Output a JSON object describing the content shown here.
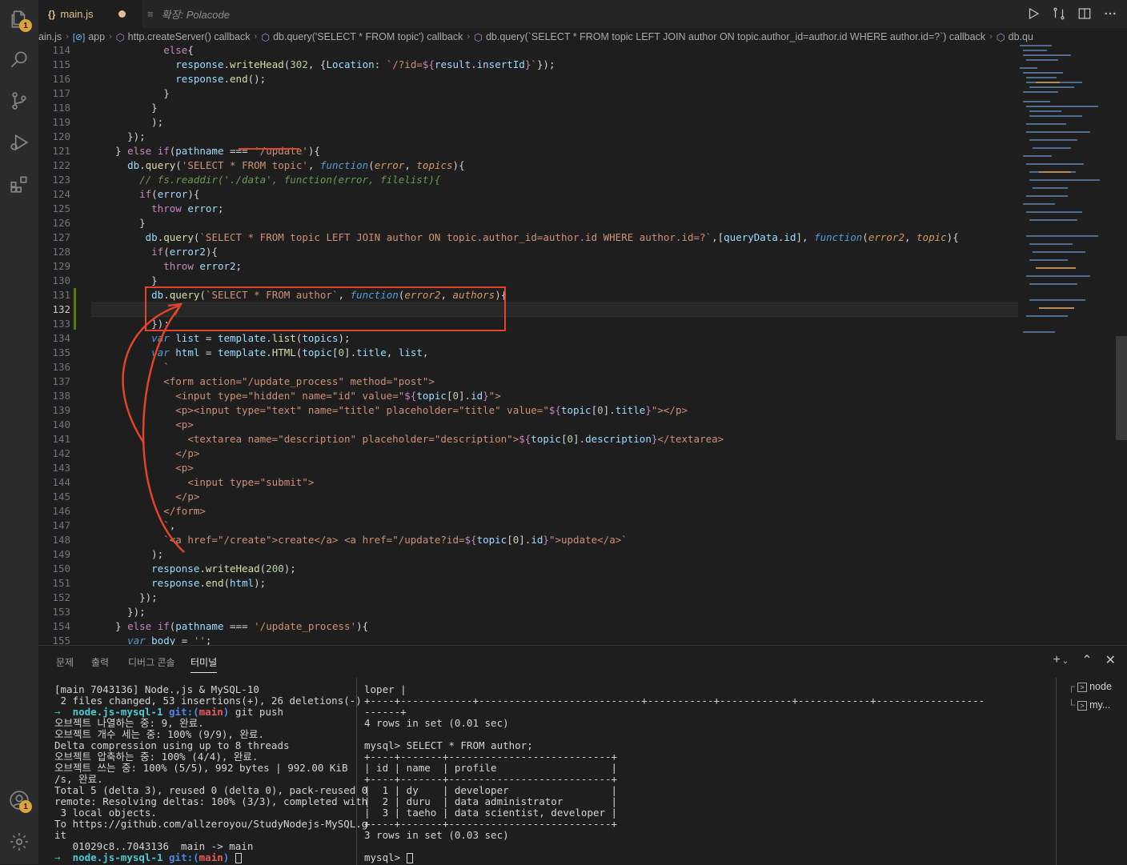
{
  "tabs": [
    {
      "icon": "{}",
      "label": "main.js",
      "modified": true,
      "active": true
    },
    {
      "icon": "≡",
      "label": "확장: Polacode",
      "active": false
    }
  ],
  "breadcrumbs": [
    "ain.js",
    "app",
    "http.createServer() callback",
    "db.query('SELECT * FROM topic') callback",
    "db.query(`SELECT * FROM topic LEFT JOIN author ON topic.author_id=author.id WHERE author.id=?`) callback",
    "db.qu"
  ],
  "activity_badges": {
    "explorer": "1",
    "account": "1"
  },
  "editor": {
    "current_line": 132,
    "lines": [
      {
        "n": 114,
        "html": "        <span class='kw'>else</span>{"
      },
      {
        "n": 115,
        "html": "          <span class='var'>response</span>.<span class='fn'>writeHead</span>(<span class='num'>302</span>, {<span class='var'>Location</span>: <span class='str'>`/?id=</span><span class='kw'>${</span><span class='var'>result</span>.<span class='var'>insertId</span><span class='kw'>}</span><span class='str'>`</span>});"
      },
      {
        "n": 116,
        "html": "          <span class='var'>response</span>.<span class='fn'>end</span>();"
      },
      {
        "n": 117,
        "html": "        }"
      },
      {
        "n": 118,
        "html": "      }"
      },
      {
        "n": 119,
        "html": "      );"
      },
      {
        "n": 120,
        "html": "  });"
      },
      {
        "n": 121,
        "html": "} <span class='kw'>else if</span>(<span class='var'>pathname</span> === <span class='str'>'/update'</span>){"
      },
      {
        "n": 122,
        "html": "  <span class='var'>db</span>.<span class='fn'>query</span>(<span class='str'>'SELECT * FROM topic'</span>, <span class='it'>function</span>(<span class='pm'>error</span>, <span class='pm'>topics</span>){"
      },
      {
        "n": 123,
        "html": "    <span class='cm'>// fs.readdir('./data', function(error, filelist){</span>"
      },
      {
        "n": 124,
        "html": "    <span class='kw'>if</span>(<span class='var'>error</span>){"
      },
      {
        "n": 125,
        "html": "      <span class='kw'>throw</span> <span class='var'>error</span>;"
      },
      {
        "n": 126,
        "html": "    }"
      },
      {
        "n": 127,
        "html": "     <span class='var'>db</span>.<span class='fn'>query</span>(<span class='str'>`SELECT * FROM topic LEFT JOIN author ON topic.author_id=author.id WHERE author.id=?`</span>,[<span class='var'>queryData</span>.<span class='var'>id</span>], <span class='it'>function</span>(<span class='pm'>error2</span>, <span class='pm'>topic</span>){"
      },
      {
        "n": 128,
        "html": "      <span class='kw'>if</span>(<span class='var'>error2</span>){"
      },
      {
        "n": 129,
        "html": "        <span class='kw'>throw</span> <span class='var'>error2</span>;"
      },
      {
        "n": 130,
        "html": "      }"
      },
      {
        "n": 131,
        "html": "      <span class='var'>db</span>.<span class='fn'>query</span>(<span class='str'>`SELECT * FROM author`</span>, <span class='it'>function</span>(<span class='pm'>error2</span>, <span class='pm'>authors</span>){"
      },
      {
        "n": 132,
        "html": ""
      },
      {
        "n": 133,
        "html": "      });"
      },
      {
        "n": 134,
        "html": "      <span class='it'>var</span> <span class='var'>list</span> = <span class='var'>template</span>.<span class='fn'>list</span>(<span class='var'>topics</span>);"
      },
      {
        "n": 135,
        "html": "      <span class='it'>var</span> <span class='var'>html</span> = <span class='var'>template</span>.<span class='fn'>HTML</span>(<span class='var'>topic</span>[<span class='num'>0</span>].<span class='var'>title</span>, <span class='var'>list</span>,"
      },
      {
        "n": 136,
        "html": "        <span class='str'>`</span>"
      },
      {
        "n": 137,
        "html": "        <span class='str'>&lt;form action=\"/update_process\" method=\"post\"&gt;</span>"
      },
      {
        "n": 138,
        "html": "          <span class='str'>&lt;input type=\"hidden\" name=\"id\" value=\"</span><span class='kw'>${</span><span class='var'>topic</span>[<span class='num'>0</span>].<span class='var'>id</span><span class='kw'>}</span><span class='str'>\"&gt;</span>"
      },
      {
        "n": 139,
        "html": "          <span class='str'>&lt;p&gt;&lt;input type=\"text\" name=\"title\" placeholder=\"title\" value=\"</span><span class='kw'>${</span><span class='var'>topic</span>[<span class='num'>0</span>].<span class='var'>title</span><span class='kw'>}</span><span class='str'>\"&gt;&lt;/p&gt;</span>"
      },
      {
        "n": 140,
        "html": "          <span class='str'>&lt;p&gt;</span>"
      },
      {
        "n": 141,
        "html": "            <span class='str'>&lt;textarea name=\"description\" placeholder=\"description\"&gt;</span><span class='kw'>${</span><span class='var'>topic</span>[<span class='num'>0</span>].<span class='var'>description</span><span class='kw'>}</span><span class='str'>&lt;/textarea&gt;</span>"
      },
      {
        "n": 142,
        "html": "          <span class='str'>&lt;/p&gt;</span>"
      },
      {
        "n": 143,
        "html": "          <span class='str'>&lt;p&gt;</span>"
      },
      {
        "n": 144,
        "html": "            <span class='str'>&lt;input type=\"submit\"&gt;</span>"
      },
      {
        "n": 145,
        "html": "          <span class='str'>&lt;/p&gt;</span>"
      },
      {
        "n": 146,
        "html": "        <span class='str'>&lt;/form&gt;</span>"
      },
      {
        "n": 147,
        "html": "        <span class='str'>`</span>,"
      },
      {
        "n": 148,
        "html": "        <span class='str'>`&lt;a href=\"/create\"&gt;create&lt;/a&gt; &lt;a href=\"/update?id=</span><span class='kw'>${</span><span class='var'>topic</span>[<span class='num'>0</span>].<span class='var'>id</span><span class='kw'>}</span><span class='str'>\"&gt;update&lt;/a&gt;`</span>"
      },
      {
        "n": 149,
        "html": "      );"
      },
      {
        "n": 150,
        "html": "      <span class='var'>response</span>.<span class='fn'>writeHead</span>(<span class='num'>200</span>);"
      },
      {
        "n": 151,
        "html": "      <span class='var'>response</span>.<span class='fn'>end</span>(<span class='var'>html</span>);"
      },
      {
        "n": 152,
        "html": "    });"
      },
      {
        "n": 153,
        "html": "  });"
      },
      {
        "n": 154,
        "html": "} <span class='kw'>else if</span>(<span class='var'>pathname</span> === <span class='str'>'/update_process'</span>){"
      },
      {
        "n": 155,
        "html": "  <span class='it'>var</span> <span class='var'>body</span> = <span class='str'>''</span>;"
      }
    ]
  },
  "panel_tabs": [
    "문제",
    "출력",
    "디버그 콘솔",
    "터미널"
  ],
  "active_panel_tab": "터미널",
  "terminal_left": [
    "[main 7043136] Node.,js & MySQL-10",
    " 2 files changed, 53 insertions(+), 26 deletions(-)",
    "→  node.js-mysql-1 git:(main) git push",
    "오브젝트 나열하는 중: 9, 완료.",
    "오브젝트 개수 세는 중: 100% (9/9), 완료.",
    "Delta compression using up to 8 threads",
    "오브젝트 압축하는 중: 100% (4/4), 완료.",
    "오브젝트 쓰는 중: 100% (5/5), 992 bytes | 992.00 KiB",
    "/s, 완료.",
    "Total 5 (delta 3), reused 0 (delta 0), pack-reused 0",
    "remote: Resolving deltas: 100% (3/3), completed with",
    " 3 local objects.",
    "To https://github.com/allzeroyou/StudyNodejs-MySQL.g",
    "it",
    "   01029c8..7043136  main -> main",
    "→  node.js-mysql-1 git:(main) "
  ],
  "terminal_right": [
    "loper |",
    "+----+------------+---------------------------+-----------+------------+------------+------------------",
    "------+",
    "4 rows in set (0.01 sec)",
    "",
    "mysql> SELECT * FROM author;",
    "+----+-------+---------------------------+",
    "| id | name  | profile                   |",
    "+----+-------+---------------------------+",
    "|  1 | dy    | developer                 |",
    "|  2 | duru  | data administrator        |",
    "|  3 | taeho | data scientist, developer |",
    "+----+-------+---------------------------+",
    "3 rows in set (0.03 sec)",
    "",
    "mysql> "
  ],
  "terminal_list": [
    "node",
    "my..."
  ]
}
